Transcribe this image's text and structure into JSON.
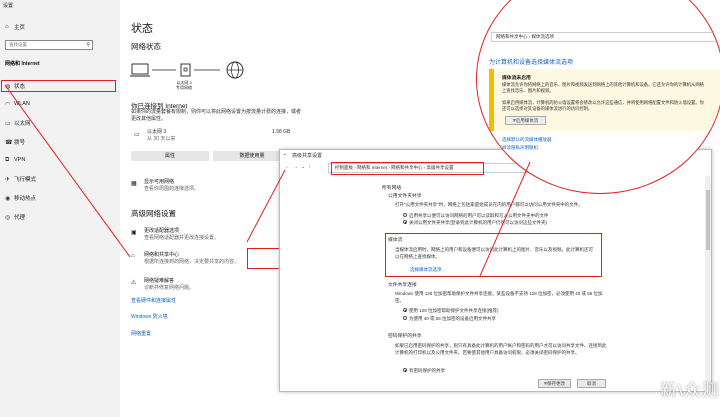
{
  "window_title": "设置",
  "sidebar": {
    "home": "主页",
    "search_placeholder": "查找设置",
    "category": "网络和 Internet",
    "items": [
      {
        "icon": "globe-icon",
        "label": "状态"
      },
      {
        "icon": "wifi-icon",
        "label": "WLAN"
      },
      {
        "icon": "ethernet-icon",
        "label": "以太网"
      },
      {
        "icon": "dialup-icon",
        "label": "拨号"
      },
      {
        "icon": "vpn-icon",
        "label": "VPN"
      },
      {
        "icon": "airplane-icon",
        "label": "飞行模式"
      },
      {
        "icon": "hotspot-icon",
        "label": "移动热点"
      },
      {
        "icon": "proxy-icon",
        "label": "代理"
      }
    ]
  },
  "status": {
    "title": "状态",
    "subtitle": "网络状态",
    "network_caption": "以太网 3\n专用网络",
    "connected_heading": "你已连接到 Internet",
    "connected_desc": "如果你的流量套餐有限制，则你可以将此网络设置为按流量计费的连接，或者更改其他属性。",
    "adapter": {
      "name": "以太网 3",
      "sub": "从 30 天以来",
      "usage": "1.98 GB"
    },
    "properties_btn": "属性",
    "data_usage_btn": "数据使用量",
    "show_networks": {
      "label": "显示可用网络",
      "desc": "查看你周围的连接选项。"
    },
    "advanced_heading": "高级网络设置",
    "adapter_options": {
      "label": "更改适配器选项",
      "desc": "查看网络适配器并更改连接设置。"
    },
    "sharing_center": {
      "label": "网络和共享中心",
      "desc": "根据所连接到的网络，决定要共享的内容。"
    },
    "troubleshooter": {
      "label": "网络疑难解答",
      "desc": "诊断并修复网络问题。"
    },
    "links": [
      "查看硬件和连接属性",
      "Windows 防火墙",
      "网络重置"
    ]
  },
  "cp": {
    "title": "高级共享设置",
    "breadcrumb": [
      "控制面板",
      "网络和 Internet",
      "网络和共享中心",
      "高级共享设置"
    ],
    "all_networks": "所有网络",
    "public_folder": {
      "heading": "公用文件夹共享",
      "desc": "打开\"公用文件夹共享\"时，网络上包括家庭组成员在内的用户都可以访问公用文件夹中的文件。",
      "opt1": "启用共享以便可以访问网络的用户可以读取和写入公用文件夹中的文件",
      "opt2": "关闭公用文件夹共享(登录到此计算机的用户仍然可以访问这些文件夹)"
    },
    "media_stream": {
      "heading": "媒体流",
      "desc": "当媒体流启用时，网络上的用户和设备便可以访问此计算机上的图片、音乐以及视频。此计算机还可以在网络上查找媒体。",
      "link": "选择媒体流选项..."
    },
    "file_sharing": {
      "heading": "文件共享连接",
      "desc": "Windows 使用 128 位加密帮助保护文件共享连接。某些设备不支持 128 位加密，必须使用 40 或 56 位加密。",
      "opt1": "使用 128 位加密帮助保护文件共享连接(推荐)",
      "opt2": "为使用 40 或 56 位加密的设备启用文件共享"
    },
    "password": {
      "heading": "密码保护的共享",
      "desc": "如果已启用密码保护的共享，则只有具备此计算机的用户帐户和密码的用户才可以访问共享文件、连接到此计算机的打印机以及公用文件夹。若要使其他用户具备访问权限，必须关闭密码保护的共享。",
      "opt1": "有密码保护的共享"
    },
    "save_btn": "保存更改",
    "cancel_btn": "取消"
  },
  "zoom": {
    "breadcrumb": [
      "网络和共享中心",
      "媒体流选项"
    ],
    "heading": "为计算机和设备选择媒体流选项",
    "section": "媒体流未启用",
    "desc1": "媒体流允许你将网络上的音乐、图片和视频发送到网络上的其他计算机和设备。它还允许你的计算机从网络上查找音乐、图片和视频。",
    "desc2": "如果启用媒体流，计算机的防火墙设置将会修改以允许这些通信，并将使用网络配置文件和防火墙设置。你还可以选择对其设备的媒体流进行的访问控制。",
    "button": "启用媒体流",
    "link1": "选择默认的流媒体播放器",
    "link2": "阅读隐私声明联机"
  },
  "watermark": "新\\众测",
  "accent_red": "#e02020",
  "link_blue": "#0a63c2"
}
